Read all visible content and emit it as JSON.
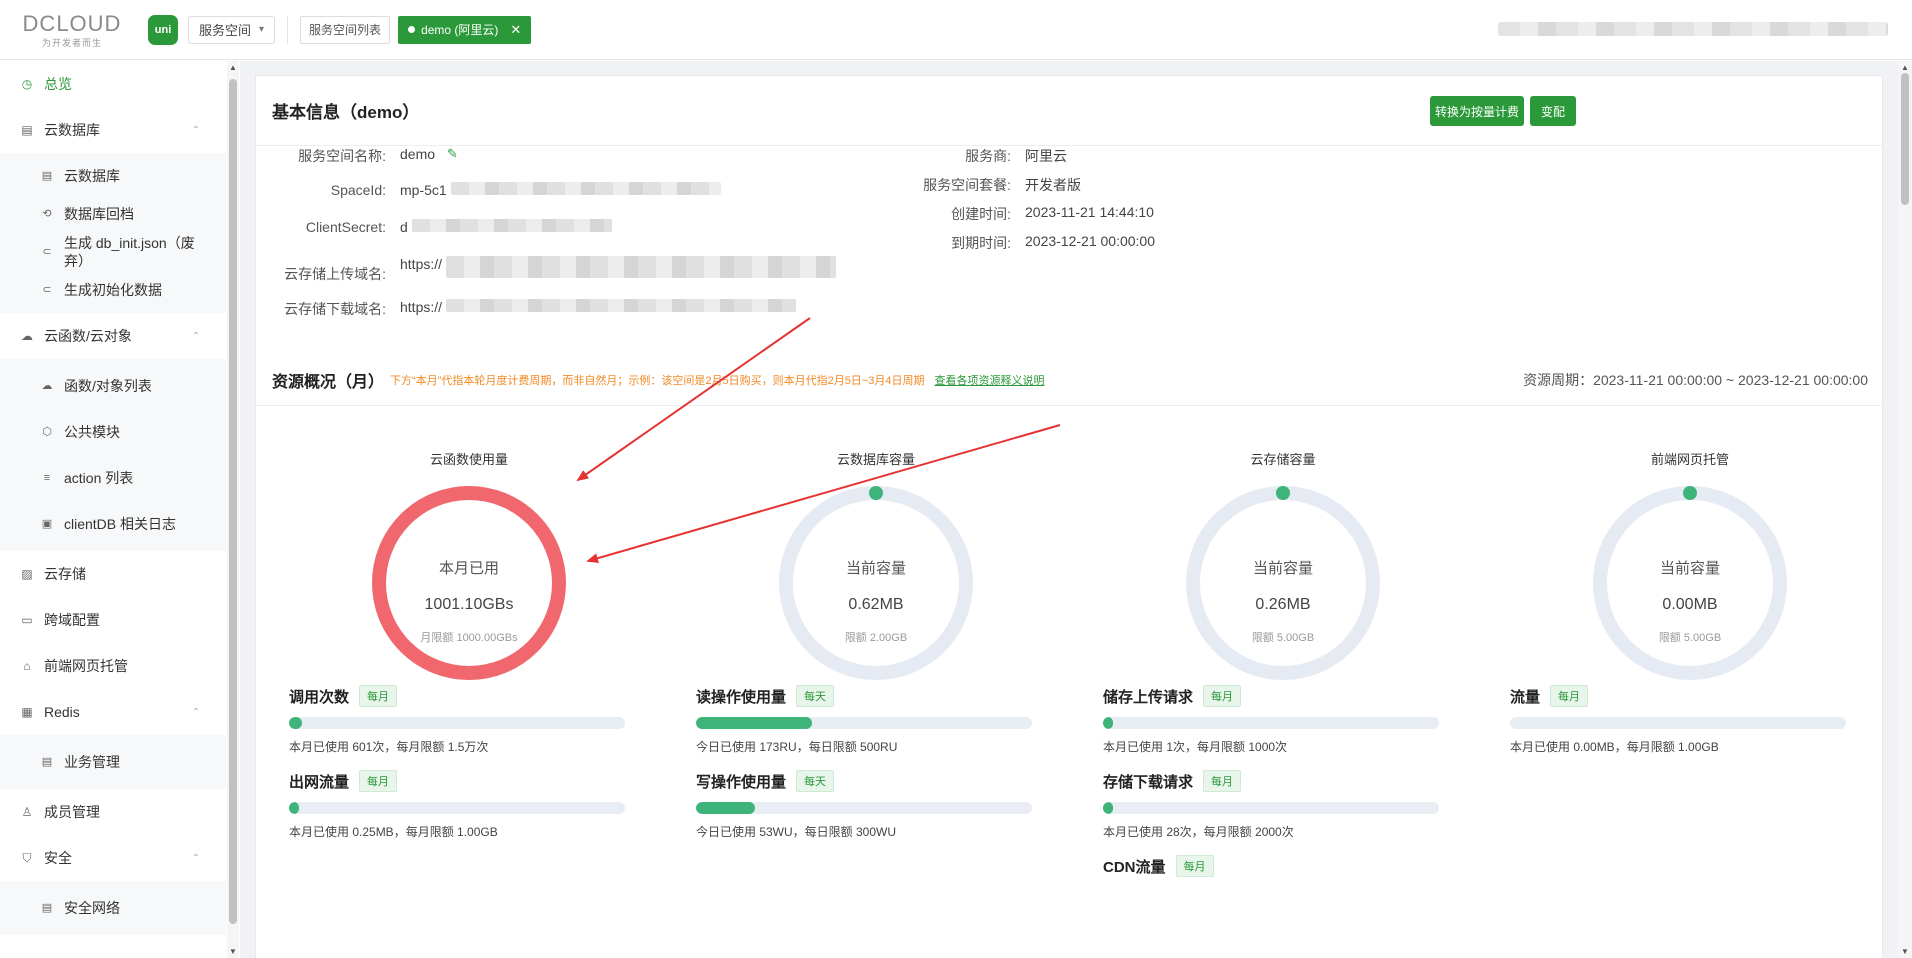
{
  "topbar": {
    "logo_text": "DCLOUD",
    "logo_slogan": "为开发者而生",
    "uni_label": "uni",
    "space_select": "服务空间",
    "tab_list": "服务空间列表",
    "tab_active": "demo (阿里云)"
  },
  "sidebar": {
    "items": [
      {
        "label": "总览",
        "icon": "dashboard-icon"
      },
      {
        "label": "云数据库",
        "icon": "database-icon"
      },
      {
        "label": "云数据库",
        "icon": "table-icon"
      },
      {
        "label": "数据库回档",
        "icon": "restore-icon"
      },
      {
        "label": "生成 db_init.json（废弃）",
        "icon": "link-icon"
      },
      {
        "label": "生成初始化数据",
        "icon": "link-icon"
      },
      {
        "label": "云函数/云对象",
        "icon": "cloud-icon"
      },
      {
        "label": "函数/对象列表",
        "icon": "cloud-icon"
      },
      {
        "label": "公共模块",
        "icon": "cube-icon"
      },
      {
        "label": "action 列表",
        "icon": "list-icon"
      },
      {
        "label": "clientDB 相关日志",
        "icon": "log-icon"
      },
      {
        "label": "云存储",
        "icon": "storage-icon"
      },
      {
        "label": "跨域配置",
        "icon": "cors-icon"
      },
      {
        "label": "前端网页托管",
        "icon": "hosting-icon"
      },
      {
        "label": "Redis",
        "icon": "redis-icon"
      },
      {
        "label": "业务管理",
        "icon": "business-icon"
      },
      {
        "label": "成员管理",
        "icon": "user-icon"
      },
      {
        "label": "安全",
        "icon": "shield-icon"
      },
      {
        "label": "安全网络",
        "icon": "network-icon"
      }
    ]
  },
  "basic": {
    "title": "基本信息（demo）",
    "btn_billing": "转换为按量计费",
    "btn_change": "变配",
    "name_label": "服务空间名称:",
    "name_value": "demo",
    "spaceid_label": "SpaceId:",
    "spaceid_value": "mp-5c1",
    "secret_label": "ClientSecret:",
    "secret_value": "d",
    "upload_label": "云存储上传域名:",
    "upload_value": "https://",
    "download_label": "云存储下载域名:",
    "download_value": "https://",
    "provider_label": "服务商:",
    "provider_value": "阿里云",
    "plan_label": "服务空间套餐:",
    "plan_value": "开发者版",
    "created_label": "创建时间:",
    "created_value": "2023-11-21 14:44:10",
    "expire_label": "到期时间:",
    "expire_value": "2023-12-21 00:00:00"
  },
  "resources": {
    "title": "资源概况（月）",
    "note": "下方“本月”代指本轮月度计费周期，而非自然月；示例：该空间是2月5日购买，则本月代指2月5日~3月4日周期",
    "link": "查看各项资源释义说明",
    "period": "资源周期：2023-11-21 00:00:00 ~ 2023-12-21 00:00:00",
    "gauges": [
      {
        "label": "云函数使用量",
        "t1": "本月已用",
        "t2": "1001.10GBs",
        "t3": "月限额 1000.00GBs",
        "ratio": 1.0011,
        "color": "#f0686e"
      },
      {
        "label": "云数据库容量",
        "t1": "当前容量",
        "t2": "0.62MB",
        "t3": "限额 2.00GB",
        "ratio": 0.0003,
        "color": "#3eb37a"
      },
      {
        "label": "云存储容量",
        "t1": "当前容量",
        "t2": "0.26MB",
        "t3": "限额 5.00GB",
        "ratio": 5e-05,
        "color": "#3eb37a"
      },
      {
        "label": "前端网页托管",
        "t1": "当前容量",
        "t2": "0.00MB",
        "t3": "限额 5.00GB",
        "ratio": 0,
        "color": "#3eb37a"
      }
    ],
    "metrics": [
      {
        "name": "调用次数",
        "badge": "每月",
        "ratio": 0.04,
        "desc": "本月已使用 601次，每月限额 1.5万次"
      },
      {
        "name": "读操作使用量",
        "badge": "每天",
        "ratio": 0.346,
        "desc": "今日已使用 173RU，每日限额 500RU"
      },
      {
        "name": "储存上传请求",
        "badge": "每月",
        "ratio": 0.001,
        "desc": "本月已使用 1次，每月限额 1000次"
      },
      {
        "name": "流量",
        "badge": "每月",
        "ratio": 0,
        "desc": "本月已使用 0.00MB，每月限额 1.00GB"
      },
      {
        "name": "出网流量",
        "badge": "每月",
        "ratio": 0.0002,
        "desc": "本月已使用 0.25MB，每月限额 1.00GB"
      },
      {
        "name": "写操作使用量",
        "badge": "每天",
        "ratio": 0.177,
        "desc": "今日已使用 53WU，每日限额 300WU"
      },
      {
        "name": "存储下载请求",
        "badge": "每月",
        "ratio": 0.014,
        "desc": "本月已使用 28次，每月限额 2000次"
      },
      {
        "name": "CDN流量",
        "badge": "每月",
        "ratio": 0,
        "desc": ""
      }
    ]
  },
  "colors": {
    "brand": "#2b9939",
    "danger": "#f0686e",
    "progress": "#3eb37a",
    "annotation": "#e53333"
  }
}
